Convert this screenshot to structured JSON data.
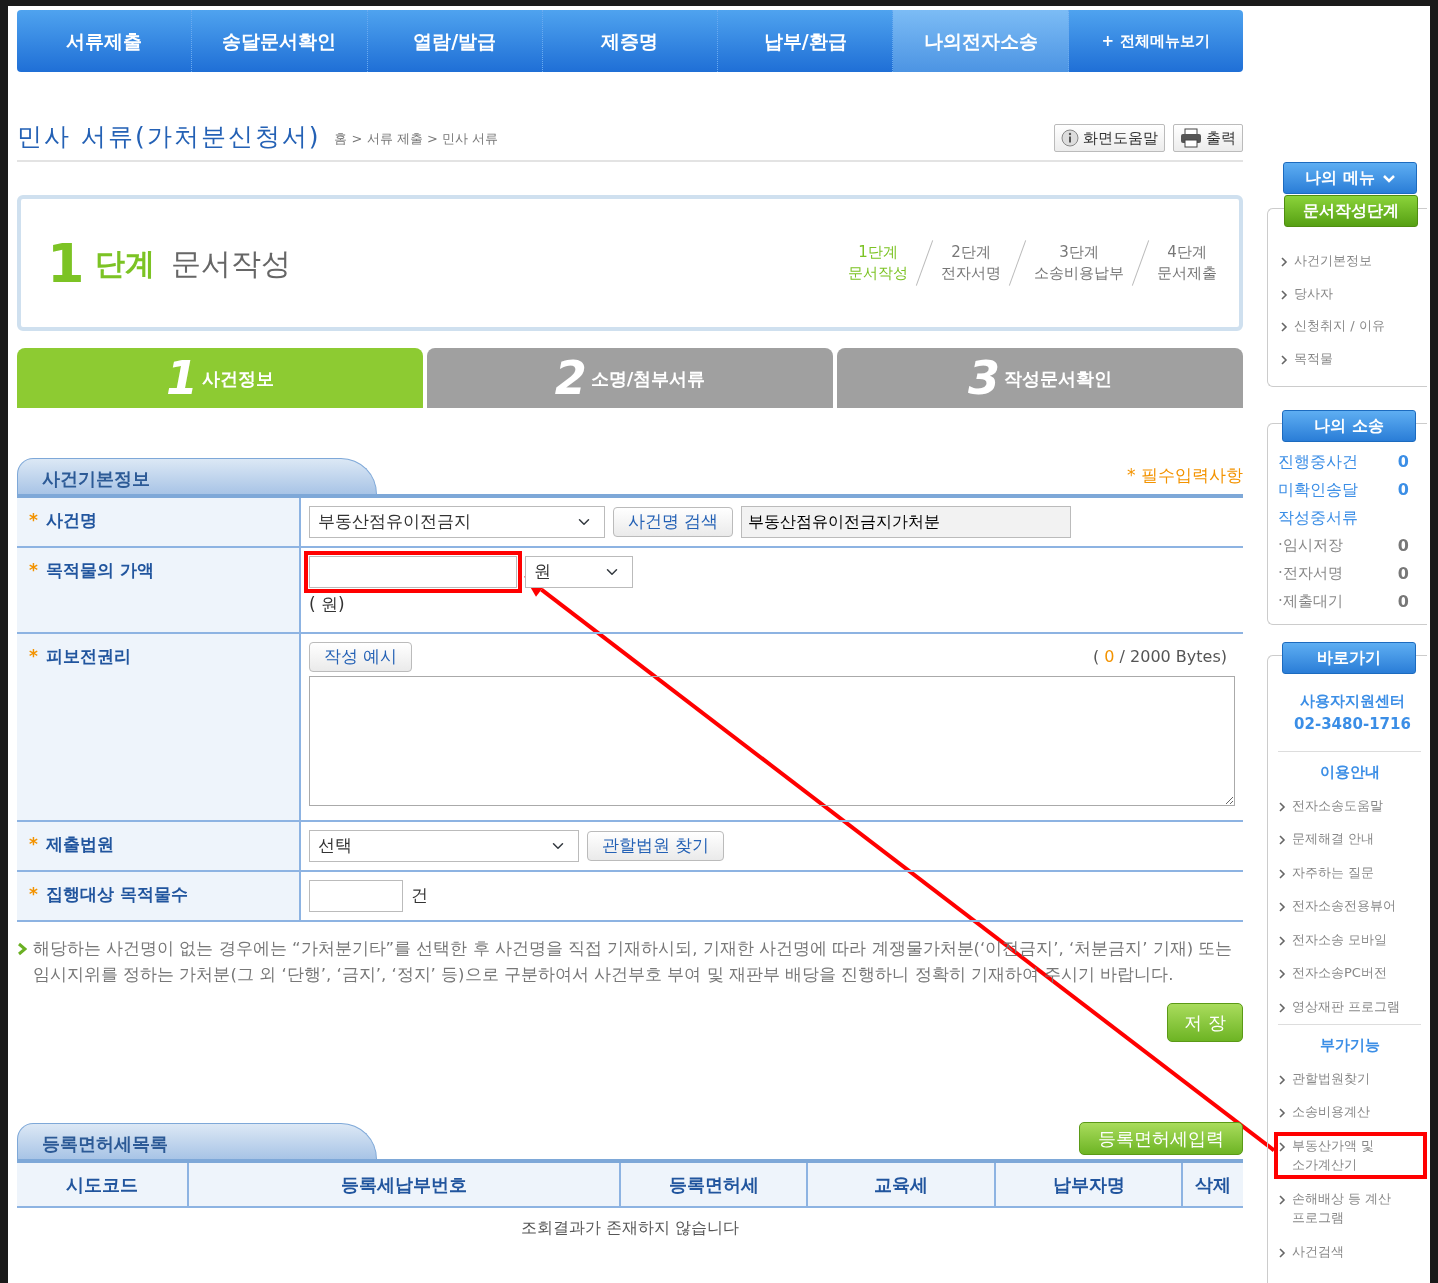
{
  "nav": {
    "items": [
      {
        "label": "서류제출",
        "selected": false
      },
      {
        "label": "송달문서확인",
        "selected": false
      },
      {
        "label": "열람/발급",
        "selected": false
      },
      {
        "label": "제증명",
        "selected": false
      },
      {
        "label": "납부/환급",
        "selected": false
      },
      {
        "label": "나의전자소송",
        "selected": true
      }
    ],
    "all_menu": {
      "icon": "+",
      "label": "전체메뉴보기"
    }
  },
  "page_title": "민사 서류(가처분신청서)",
  "breadcrumb": "홈 > 서류 제출 > 민사 서류",
  "toolbar": [
    {
      "kind": "help",
      "label": "화면도움말"
    },
    {
      "kind": "print",
      "label": "출력"
    }
  ],
  "stage": {
    "number": "1",
    "unit": "단계",
    "name": "문서작성",
    "steps": [
      {
        "step": "1단계",
        "name": "문서작성",
        "selected": true
      },
      {
        "step": "2단계",
        "name": "전자서명",
        "selected": false
      },
      {
        "step": "3단계",
        "name": "소송비용납부",
        "selected": false
      },
      {
        "step": "4단계",
        "name": "문서제출",
        "selected": false
      }
    ]
  },
  "tabs": [
    {
      "number": "1",
      "label": "사건정보",
      "selected": true
    },
    {
      "number": "2",
      "label": "소명/첨부서류",
      "selected": false
    },
    {
      "number": "3",
      "label": "작성문서확인",
      "selected": false
    }
  ],
  "section": {
    "title": "사건기본정보",
    "required_note": "* 필수입력사항"
  },
  "form": {
    "rows": [
      {
        "kind": "case_name",
        "mark": "*",
        "label": "사건명",
        "select": "부동산점유이전금지",
        "button": "사건명 검색",
        "value": "부동산점유이전금지가처분"
      },
      {
        "kind": "amount",
        "mark": "*",
        "label": "목적물의 가액",
        "highlighted": true,
        "unit_select": "원",
        "hint": "( 원)"
      },
      {
        "kind": "textarea",
        "mark": "*",
        "label": "피보전권리",
        "button": "작성 예시",
        "counter": {
          "open": "(",
          "count": "0",
          "total": "/ 2000 Bytes)"
        }
      },
      {
        "kind": "select_button",
        "mark": "*",
        "label": "제출법원",
        "select": "선택",
        "button": "관할법원 찾기"
      },
      {
        "kind": "count",
        "mark": "*",
        "label": "집행대상 목적물수",
        "unit": "건"
      }
    ]
  },
  "note": "해당하는 사건명이 없는 경우에는 “가처분기타”를 선택한 후 사건명을 직접 기재하시되, 기재한 사건명에 따라 계쟁물가처분(‘이전금지’, ‘처분금지’ 기재) 또는 임시지위를 정하는 가처분(그 외 ‘단행’, ‘금지’, ‘정지’ 등)으로 구분하여서 사건부호 부여 및 재판부 배당을 진행하니 정확히 기재하여 주시기 바랍니다.",
  "save_button": "저 장",
  "tax_section": {
    "title": "등록면허세목록",
    "button": "등록면허세입력",
    "columns": [
      "시도코드",
      "등록세납부번호",
      "등록면허세",
      "교육세",
      "납부자명",
      "삭제"
    ],
    "empty_message": "조회결과가 존재하지 않습니다"
  },
  "sidebar": {
    "my_menu": "나의 메뉴",
    "steps_box": {
      "title": "문서작성단계",
      "items": [
        "사건기본정보",
        "당사자",
        "신청취지 / 이유",
        "목적물"
      ]
    },
    "cases_box": {
      "title": "나의 소송",
      "rows": [
        {
          "kind": "main",
          "label": "진행중사건",
          "count": "0"
        },
        {
          "kind": "main",
          "label": "미확인송달",
          "count": "0"
        },
        {
          "kind": "main",
          "label": "작성중서류"
        },
        {
          "kind": "sub",
          "label": "·임시저장",
          "count": "0"
        },
        {
          "kind": "sub",
          "label": "·전자서명",
          "count": "0"
        },
        {
          "kind": "sub",
          "label": "·제출대기",
          "count": "0"
        }
      ]
    },
    "shortcuts": {
      "title": "바로가기",
      "support": "사용자지원센터",
      "phone": "02-3480-1716",
      "groups": [
        {
          "heading": "이용안내",
          "items": [
            {
              "label": "전자소송도움말",
              "highlighted": false
            },
            {
              "label": "문제해결 안내",
              "highlighted": false
            },
            {
              "label": "자주하는 질문",
              "highlighted": false
            },
            {
              "label": "전자소송전용뷰어",
              "highlighted": false
            },
            {
              "label": "전자소송 모바일",
              "highlighted": false
            },
            {
              "label": "전자소송PC버전",
              "highlighted": false
            },
            {
              "label": "영상재판 프로그램",
              "highlighted": false
            }
          ]
        },
        {
          "heading": "부가기능",
          "items": [
            {
              "label": "관할법원찾기",
              "highlighted": false
            },
            {
              "label": "소송비용계산",
              "highlighted": false
            },
            {
              "label": "부동산가액 및 소가계산기",
              "highlighted": true
            },
            {
              "label": "손해배상 등 계산 프로그램",
              "highlighted": false
            },
            {
              "label": "사건검색",
              "highlighted": false
            }
          ]
        }
      ]
    }
  },
  "annotation": {
    "arrow": true
  }
}
